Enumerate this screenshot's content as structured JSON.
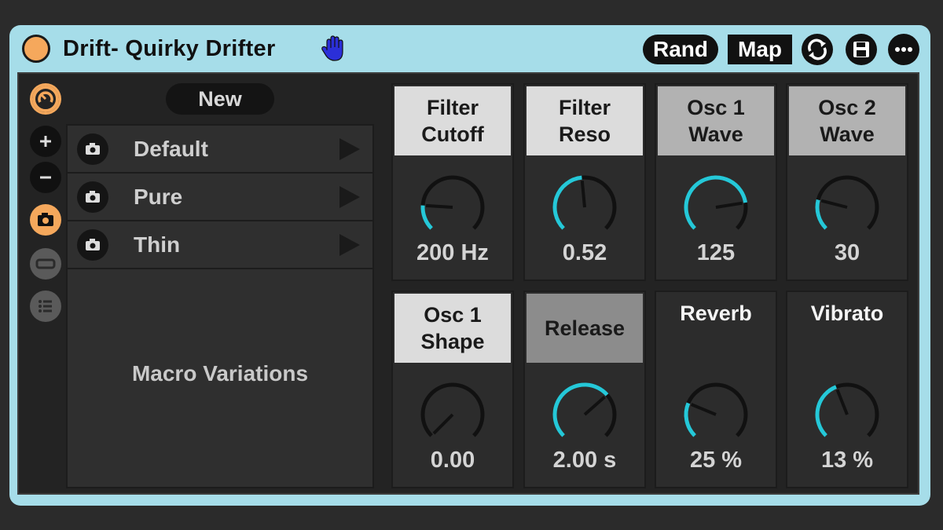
{
  "device": {
    "title": "Drift- Quirky Drifter",
    "rand_label": "Rand",
    "map_label": "Map"
  },
  "variations": {
    "new_label": "New",
    "items": [
      "Default",
      "Pure",
      "Thin"
    ],
    "footer_label": "Macro Variations"
  },
  "macros": [
    {
      "label": "Filter Cutoff",
      "value": "200 Hz",
      "fraction": 0.18,
      "head": "light"
    },
    {
      "label": "Filter Reso",
      "value": "0.52",
      "fraction": 0.48,
      "head": "light"
    },
    {
      "label": "Osc 1 Wave",
      "value": "125",
      "fraction": 0.8,
      "head": "mid"
    },
    {
      "label": "Osc 2 Wave",
      "value": "30",
      "fraction": 0.22,
      "head": "mid"
    },
    {
      "label": "Osc 1 Shape",
      "value": "0.00",
      "fraction": 0.0,
      "head": "light"
    },
    {
      "label": "Release",
      "value": "2.00 s",
      "fraction": 0.68,
      "head": "dark"
    },
    {
      "label": "Reverb",
      "value": "25 %",
      "fraction": 0.25,
      "head": "none"
    },
    {
      "label": "Vibrato",
      "value": "13 %",
      "fraction": 0.42,
      "head": "none"
    }
  ],
  "colors": {
    "accent": "#f5a85c",
    "knob_arc": "#25c8d8",
    "title_bar": "#a6dde9",
    "hand_icon": "#2b2fd8"
  },
  "icons": [
    "hand-icon",
    "hot-swap-icon",
    "save-icon",
    "more-icon",
    "macro-map-icon",
    "plus-icon",
    "minus-icon",
    "camera-icon",
    "bar-icon",
    "list-icon",
    "play-icon"
  ]
}
